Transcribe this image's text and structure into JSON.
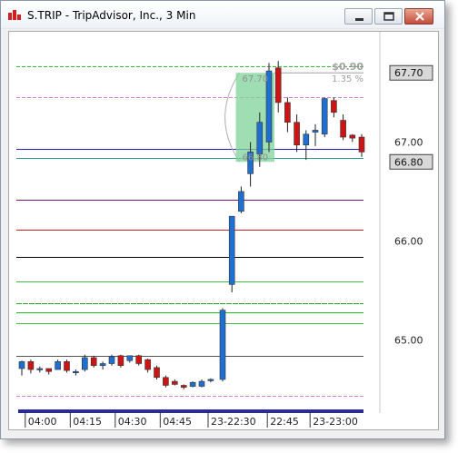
{
  "window": {
    "title": "S.TRIP - TripAdvisor, Inc., 3 Min"
  },
  "chart_data": {
    "type": "candlestick",
    "x_tick_labels": [
      "04:00",
      "04:15",
      "04:30",
      "04:45",
      "23-22:30",
      "22:45",
      "23-23:00"
    ],
    "y_tick_labels": [
      "67.00",
      "66.00",
      "65.00"
    ],
    "ylim": [
      64.37,
      67.95
    ],
    "colors": {
      "up": "#1f6fd0",
      "down": "#cc1414"
    },
    "candles": [
      {
        "time": "03:54",
        "o": 64.71,
        "h": 64.79,
        "l": 64.64,
        "c": 64.78
      },
      {
        "time": "03:57",
        "o": 64.78,
        "h": 64.8,
        "l": 64.66,
        "c": 64.7
      },
      {
        "time": "04:00",
        "o": 64.7,
        "h": 64.73,
        "l": 64.67,
        "c": 64.71
      },
      {
        "time": "04:03",
        "o": 64.71,
        "h": 64.71,
        "l": 64.65,
        "c": 64.68
      },
      {
        "time": "04:06",
        "o": 64.7,
        "h": 64.8,
        "l": 64.7,
        "c": 64.78
      },
      {
        "time": "04:09",
        "o": 64.78,
        "h": 64.8,
        "l": 64.67,
        "c": 64.69
      },
      {
        "time": "04:12",
        "o": 64.68,
        "h": 64.7,
        "l": 64.64,
        "c": 64.68
      },
      {
        "time": "04:15",
        "o": 64.7,
        "h": 64.85,
        "l": 64.68,
        "c": 64.82
      },
      {
        "time": "04:18",
        "o": 64.82,
        "h": 64.84,
        "l": 64.72,
        "c": 64.74
      },
      {
        "time": "04:21",
        "o": 64.74,
        "h": 64.78,
        "l": 64.7,
        "c": 64.76
      },
      {
        "time": "04:24",
        "o": 64.76,
        "h": 64.85,
        "l": 64.74,
        "c": 64.83
      },
      {
        "time": "04:27",
        "o": 64.84,
        "h": 64.85,
        "l": 64.72,
        "c": 64.74
      },
      {
        "time": "04:30",
        "o": 64.79,
        "h": 64.84,
        "l": 64.77,
        "c": 64.84
      },
      {
        "time": "04:33",
        "o": 64.84,
        "h": 64.85,
        "l": 64.74,
        "c": 64.76
      },
      {
        "time": "04:36",
        "o": 64.8,
        "h": 64.81,
        "l": 64.67,
        "c": 64.7
      },
      {
        "time": "04:39",
        "o": 64.72,
        "h": 64.74,
        "l": 64.6,
        "c": 64.62
      },
      {
        "time": "04:42",
        "o": 64.62,
        "h": 64.64,
        "l": 64.52,
        "c": 64.54
      },
      {
        "time": "04:45",
        "o": 64.58,
        "h": 64.6,
        "l": 64.54,
        "c": 64.55
      },
      {
        "time": "04:48",
        "o": 64.54,
        "h": 64.55,
        "l": 64.5,
        "c": 64.52
      },
      {
        "time": "04:51",
        "o": 64.53,
        "h": 64.58,
        "l": 64.52,
        "c": 64.57
      },
      {
        "time": "04:54",
        "o": 64.53,
        "h": 64.6,
        "l": 64.52,
        "c": 64.58
      },
      {
        "time": "04:57",
        "o": 64.59,
        "h": 64.61,
        "l": 64.57,
        "c": 64.6
      },
      {
        "time": "22:24",
        "o": 64.6,
        "h": 65.32,
        "l": 64.58,
        "c": 65.3
      },
      {
        "time": "22:27",
        "o": 65.56,
        "h": 66.25,
        "l": 65.48,
        "c": 66.25
      },
      {
        "time": "22:30",
        "o": 66.3,
        "h": 66.55,
        "l": 66.28,
        "c": 66.5
      },
      {
        "time": "22:33",
        "o": 66.68,
        "h": 67.0,
        "l": 66.55,
        "c": 66.9
      },
      {
        "time": "22:36",
        "o": 66.88,
        "h": 67.3,
        "l": 66.75,
        "c": 67.2
      },
      {
        "time": "22:39",
        "o": 67.0,
        "h": 67.8,
        "l": 66.9,
        "c": 67.72
      },
      {
        "time": "22:42",
        "o": 67.75,
        "h": 67.82,
        "l": 67.3,
        "c": 67.4
      },
      {
        "time": "22:45",
        "o": 67.4,
        "h": 67.45,
        "l": 67.1,
        "c": 67.2
      },
      {
        "time": "22:48",
        "o": 67.2,
        "h": 67.28,
        "l": 66.9,
        "c": 66.97
      },
      {
        "time": "22:51",
        "o": 66.97,
        "h": 67.12,
        "l": 66.82,
        "c": 67.08
      },
      {
        "time": "22:54",
        "o": 67.1,
        "h": 67.18,
        "l": 66.96,
        "c": 67.12
      },
      {
        "time": "22:57",
        "o": 67.08,
        "h": 67.45,
        "l": 67.05,
        "c": 67.44
      },
      {
        "time": "23:00",
        "o": 67.42,
        "h": 67.45,
        "l": 67.25,
        "c": 67.3
      },
      {
        "time": "23:03",
        "o": 67.22,
        "h": 67.28,
        "l": 67.02,
        "c": 67.05
      },
      {
        "time": "23:06",
        "o": 67.07,
        "h": 67.08,
        "l": 67.0,
        "c": 67.04
      },
      {
        "time": "23:09",
        "o": 67.05,
        "h": 67.08,
        "l": 66.85,
        "c": 66.9
      }
    ],
    "levels": [
      {
        "value": 67.77,
        "color": "#3ab83a",
        "dash": "4,2"
      },
      {
        "value": 67.45,
        "color": "#d080d0",
        "dash": "4,2"
      },
      {
        "value": 66.93,
        "color": "#2020c0",
        "dash": ""
      },
      {
        "value": 66.84,
        "color": "#2a9a90",
        "dash": ""
      },
      {
        "value": 66.42,
        "color": "#6a1a70",
        "dash": ""
      },
      {
        "value": 66.11,
        "color": "#cc2222",
        "dash": ""
      },
      {
        "value": 65.84,
        "color": "#000000",
        "dash": ""
      },
      {
        "value": 65.59,
        "color": "#40c040",
        "dash": ""
      },
      {
        "value": 65.37,
        "color": "#20b020",
        "dash": "6,1"
      },
      {
        "value": 65.28,
        "color": "#20c020",
        "dash": ""
      },
      {
        "value": 65.17,
        "color": "#40c040",
        "dash": ""
      },
      {
        "value": 64.84,
        "color": "#555555",
        "dash": ""
      },
      {
        "value": 64.43,
        "color": "#d080d0",
        "dash": "4,2"
      }
    ],
    "price_labels": [
      {
        "value": 67.7,
        "label": "67.70"
      },
      {
        "value": 66.8,
        "label": "66.80"
      }
    ],
    "annotation": {
      "change": "$0.90",
      "percent": "1.35 %",
      "from": "66.80",
      "to": "67.70"
    }
  }
}
